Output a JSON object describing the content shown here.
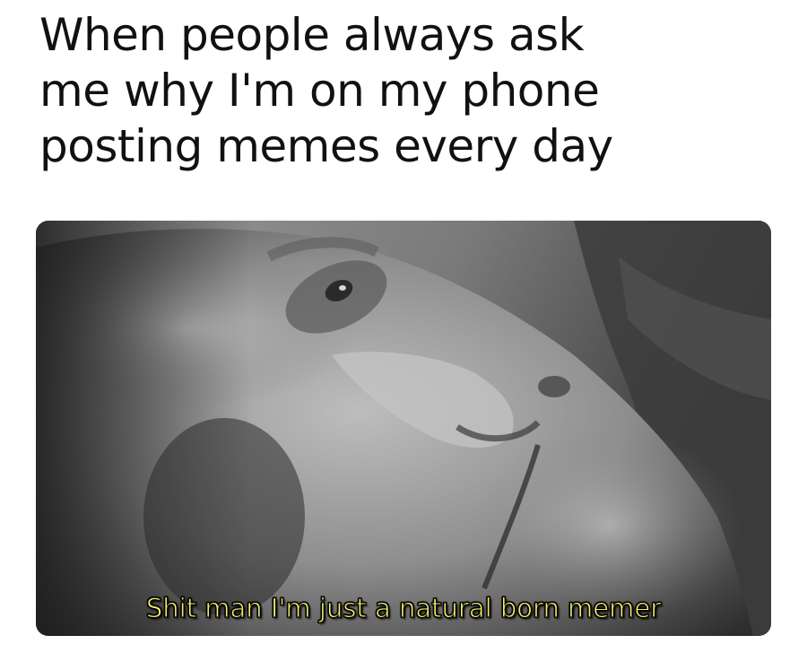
{
  "caption": {
    "lines": [
      "When people always ask",
      "me why I'm on my phone",
      "posting memes every day"
    ]
  },
  "image": {
    "subject": "black-and-white close-up of a man lying down",
    "subtitle": "Shit man I'm just a natural born memer",
    "subtitle_color": "#f2ef6a"
  }
}
